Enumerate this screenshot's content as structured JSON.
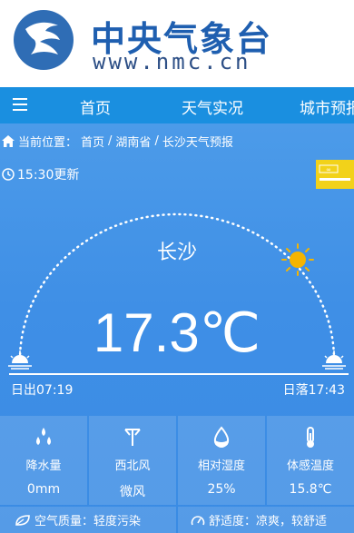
{
  "header": {
    "title": "中央气象台",
    "url": "www.nmc.cn"
  },
  "nav": {
    "items": [
      "首页",
      "天气实况",
      "城市预报"
    ]
  },
  "breadcrumb": {
    "label": "当前位置：",
    "items": [
      "首页",
      "湖南省",
      "长沙天气预报"
    ],
    "separator": "/"
  },
  "weather": {
    "updated": "15:30更新",
    "city": "长沙",
    "temperature": "17.3℃",
    "sunrise": "日出07:19",
    "sunset": "日落17:43"
  },
  "stats": [
    {
      "label": "降水量",
      "value": "0mm",
      "icon": "raindrops-icon"
    },
    {
      "label": "西北风",
      "value": "微风",
      "icon": "wind-vane-icon"
    },
    {
      "label": "相对湿度",
      "value": "25%",
      "icon": "humidity-drop-icon"
    },
    {
      "label": "体感温度",
      "value": "15.8℃",
      "icon": "thermometer-icon"
    }
  ],
  "bottom": {
    "air_quality": "空气质量：轻度污染",
    "comfort": "舒适度：凉爽，较舒适"
  },
  "colors": {
    "brand": "#1f5fb0",
    "nav": "#1a8fe0",
    "panel": "#3f8fe6",
    "badge": "#f2d21a",
    "sun": "#f5b400"
  }
}
